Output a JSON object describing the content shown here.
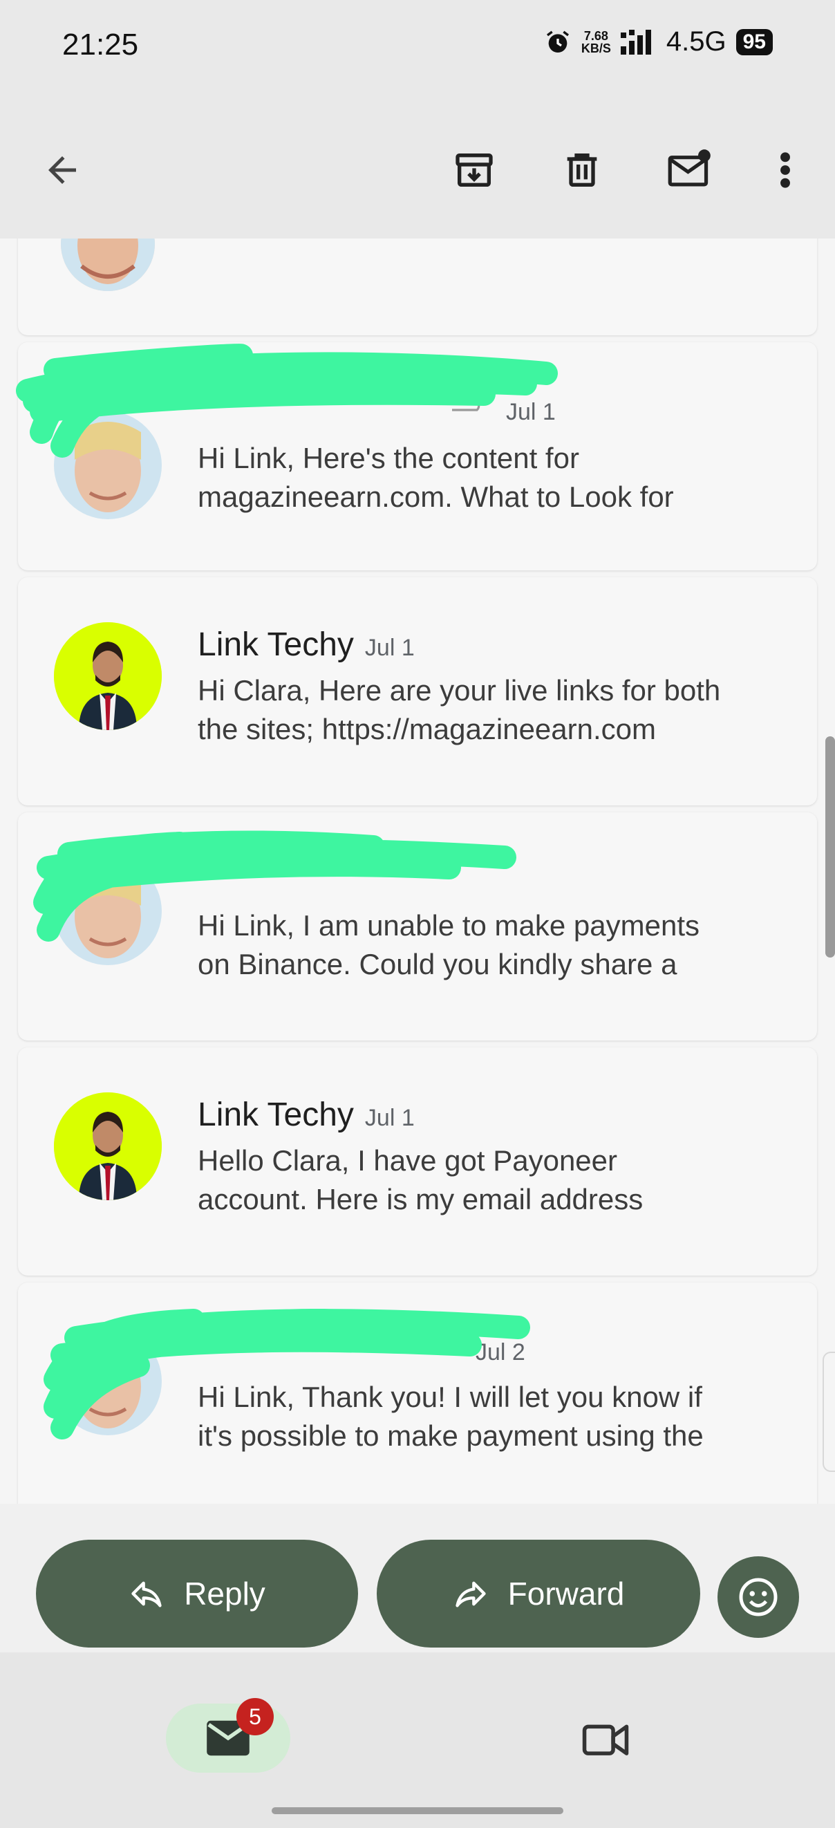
{
  "status": {
    "time": "21:25",
    "net_speed_value": "7.68",
    "net_speed_unit": "KB/S",
    "network": "4.5G",
    "battery": "95",
    "icons": [
      "alarm-icon",
      "signal-icon"
    ]
  },
  "toolbar": {
    "icons": [
      "back-arrow-icon",
      "archive-icon",
      "delete-icon",
      "mark-unread-icon",
      "more-vert-icon"
    ]
  },
  "thread": [
    {
      "sender": "",
      "date": "",
      "snippet_line1": "",
      "snippet_line2": ""
    },
    {
      "sender": "",
      "date": "Jul 1",
      "snippet_line1": "Hi Link, Here's the content for",
      "snippet_line2": "magazineearn.com. What to Look for"
    },
    {
      "sender": "Link Techy",
      "date": "Jul 1",
      "snippet_line1": "Hi Clara, Here are your live links for both",
      "snippet_line2": "the sites; https://magazineearn.com"
    },
    {
      "sender": "",
      "date": "",
      "snippet_line1": "Hi Link, I am unable to make payments",
      "snippet_line2": "on Binance. Could you kindly share a"
    },
    {
      "sender": "Link Techy",
      "date": "Jul 1",
      "snippet_line1": "Hello Clara, I have got Payoneer",
      "snippet_line2": "account. Here is my email address"
    },
    {
      "sender": "",
      "date": "Jul 2",
      "snippet_line1": "Hi Link, Thank you! I will let you know if",
      "snippet_line2": "it's possible to make payment using the"
    }
  ],
  "actions": {
    "reply_label": "Reply",
    "forward_label": "Forward"
  },
  "bottom_nav": {
    "mail_badge": "5"
  },
  "colors": {
    "action_green": "#4e6350",
    "scribble_green": "#3ef5a0",
    "badge_red": "#c5221f",
    "avatar_bg_link": "#d9ff00"
  }
}
